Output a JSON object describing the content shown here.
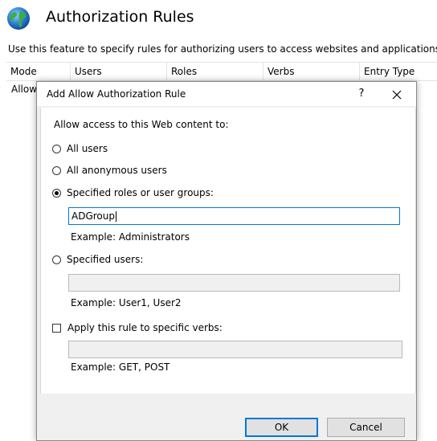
{
  "feature": {
    "title": "Authorization Rules",
    "description": "Use this feature to specify rules for authorizing users to access websites and applications.",
    "icon": "globe-icon"
  },
  "grid": {
    "columns": [
      "Mode",
      "Users",
      "Roles",
      "Verbs",
      "Entry Type"
    ],
    "rows": [
      {
        "mode": "Allow"
      }
    ]
  },
  "dialog": {
    "title": "Add Allow Authorization Rule",
    "help_label": "?",
    "close_label": "✕",
    "intro": "Allow access to this Web content to:",
    "options": {
      "all_users": "All users",
      "anonymous_users": "All anonymous users",
      "specified_roles": "Specified roles or user groups:",
      "specified_users": "Specified users:"
    },
    "selected_option": "specified_roles",
    "roles_value": "ADGroup",
    "roles_example": "Example: Administrators",
    "users_value": "",
    "users_example": "Example: User1, User2",
    "verbs_checkbox": "Apply this rule to specific verbs:",
    "verbs_checked": false,
    "verbs_value": "",
    "verbs_example": "Example: GET, POST",
    "ok_label": "OK",
    "cancel_label": "Cancel"
  },
  "colors": {
    "accent": "#0078d7",
    "dialog_bg": "#f0f0f0",
    "button_bg": "#e1e1e1"
  }
}
